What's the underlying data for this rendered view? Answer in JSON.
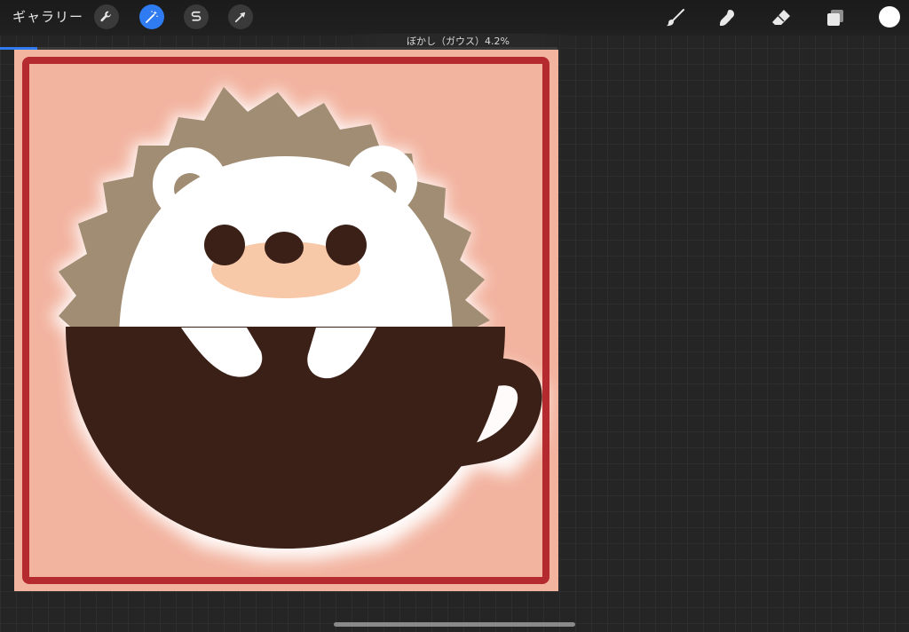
{
  "topbar": {
    "gallery_label": "ギャラリー",
    "left_tools": [
      {
        "icon": "wrench-icon",
        "active": false
      },
      {
        "icon": "magic-wand-icon",
        "active": true
      },
      {
        "icon": "selection-s-icon",
        "active": false
      },
      {
        "icon": "arrow-cursor-icon",
        "active": false
      }
    ],
    "right_tools": [
      {
        "icon": "brush-icon"
      },
      {
        "icon": "smudge-icon"
      },
      {
        "icon": "eraser-icon"
      },
      {
        "icon": "layers-icon"
      }
    ],
    "active_color": "#ffffff",
    "accent_color": "#2e7bf2"
  },
  "status": {
    "text": "ぼかし（ガウス）4.2%",
    "progress_percent": 4.2
  },
  "canvas": {
    "background": "#f2b39f",
    "border_color": "#b52a2e",
    "cup_color": "#3b2017",
    "spikes_color": "#a08d74",
    "face_color": "#ffffff",
    "muzzle_color": "#f7c9a9"
  }
}
